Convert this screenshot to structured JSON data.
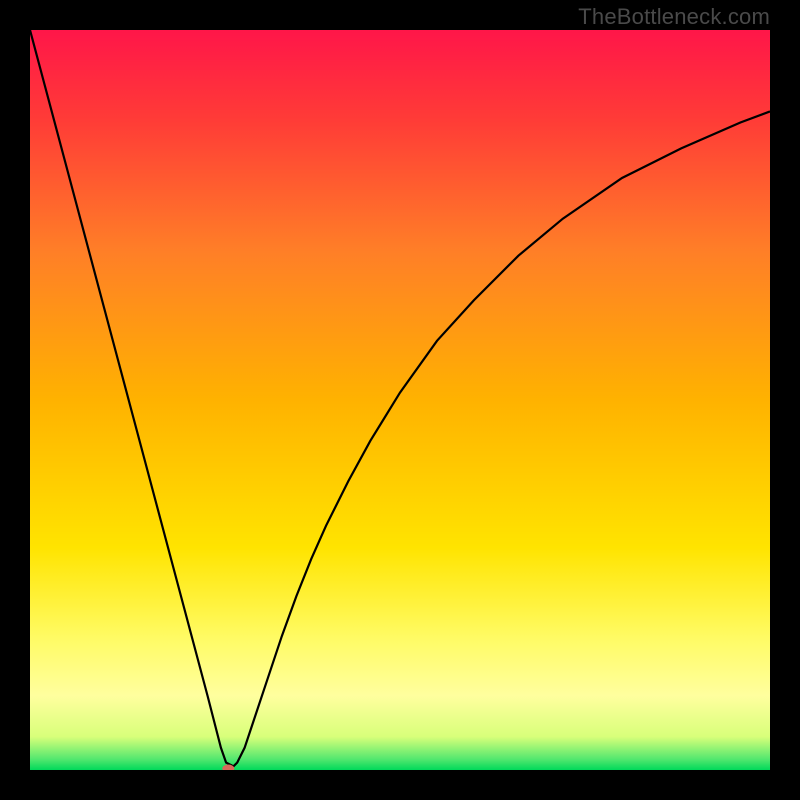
{
  "watermark": "TheBottleneck.com",
  "chart_data": {
    "type": "line",
    "title": "",
    "xlabel": "",
    "ylabel": "",
    "xlim": [
      0,
      100
    ],
    "ylim": [
      0,
      100
    ],
    "background_gradient": {
      "stops": [
        {
          "offset": 0.0,
          "color": "#ff1649"
        },
        {
          "offset": 0.12,
          "color": "#ff3b37"
        },
        {
          "offset": 0.3,
          "color": "#ff7f27"
        },
        {
          "offset": 0.5,
          "color": "#ffb200"
        },
        {
          "offset": 0.7,
          "color": "#ffe400"
        },
        {
          "offset": 0.82,
          "color": "#fffb63"
        },
        {
          "offset": 0.9,
          "color": "#ffff9e"
        },
        {
          "offset": 0.955,
          "color": "#d8ff7a"
        },
        {
          "offset": 0.985,
          "color": "#55e86f"
        },
        {
          "offset": 1.0,
          "color": "#00d95a"
        }
      ]
    },
    "series": [
      {
        "name": "bottleneck-curve",
        "color": "#000000",
        "x": [
          0,
          2,
          4,
          6,
          8,
          10,
          12,
          14,
          16,
          18,
          20,
          22,
          24,
          25.8,
          26.5,
          27.5,
          28,
          29,
          30,
          32,
          34,
          36,
          38,
          40,
          43,
          46,
          50,
          55,
          60,
          66,
          72,
          80,
          88,
          96,
          100
        ],
        "y": [
          100,
          92.5,
          85,
          77.5,
          70,
          62.5,
          55,
          47.5,
          40,
          32.5,
          25,
          17.5,
          10,
          3,
          1,
          0.5,
          1,
          3,
          6,
          12,
          18,
          23.5,
          28.5,
          33,
          39,
          44.5,
          51,
          58,
          63.5,
          69.5,
          74.5,
          80,
          84,
          87.5,
          89
        ]
      }
    ],
    "marker": {
      "name": "minimum-marker",
      "x": 26.8,
      "y": 0.2,
      "color": "#d86a5a",
      "rx": 6,
      "ry": 4
    }
  }
}
